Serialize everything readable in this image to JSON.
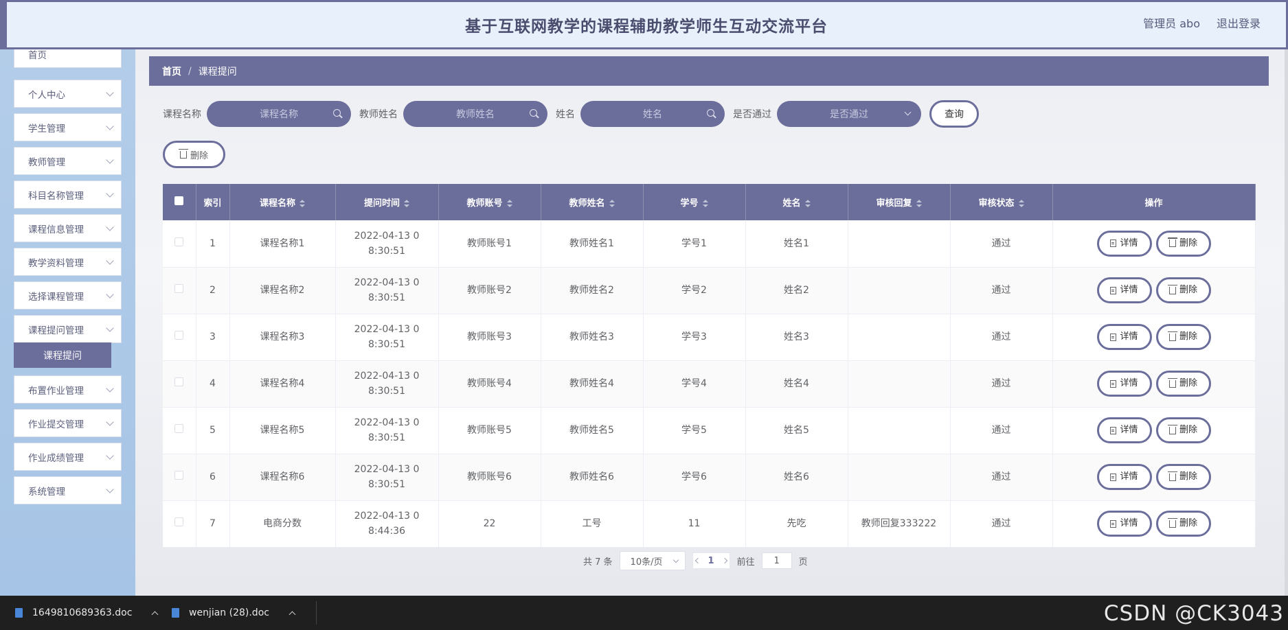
{
  "header": {
    "title": "基于互联网教学的课程辅助教学师生互动交流平台",
    "user": "管理员 abo",
    "logout": "退出登录"
  },
  "sidebar": {
    "items": [
      {
        "label": "首页"
      },
      {
        "label": "个人中心"
      },
      {
        "label": "学生管理"
      },
      {
        "label": "教师管理"
      },
      {
        "label": "科目名称管理"
      },
      {
        "label": "课程信息管理"
      },
      {
        "label": "教学资料管理"
      },
      {
        "label": "选择课程管理"
      },
      {
        "label": "课程提问管理"
      },
      {
        "label": "布置作业管理"
      },
      {
        "label": "作业提交管理"
      },
      {
        "label": "作业成绩管理"
      },
      {
        "label": "系统管理"
      }
    ],
    "active_sub": "课程提问"
  },
  "breadcrumb": {
    "home": "首页",
    "separator": "/",
    "current": "课程提问"
  },
  "filters": {
    "course_label": "课程名称",
    "course_placeholder": "课程名称",
    "teacher_label": "教师姓名",
    "teacher_placeholder": "教师姓名",
    "name_label": "姓名",
    "name_placeholder": "姓名",
    "passed_label": "是否通过",
    "passed_placeholder": "是否通过",
    "query_button": "查询"
  },
  "bulk_delete": "删除",
  "table": {
    "columns": [
      "索引",
      "课程名称",
      "提问时间",
      "教师账号",
      "教师姓名",
      "学号",
      "姓名",
      "审核回复",
      "审核状态",
      "操作"
    ],
    "rows": [
      {
        "index": "1",
        "course": "课程名称1",
        "time": "2022-04-13 08:30:51",
        "teacher_account": "教师账号1",
        "teacher_name": "教师姓名1",
        "student_no": "学号1",
        "name": "姓名1",
        "reply": "",
        "status": "通过"
      },
      {
        "index": "2",
        "course": "课程名称2",
        "time": "2022-04-13 08:30:51",
        "teacher_account": "教师账号2",
        "teacher_name": "教师姓名2",
        "student_no": "学号2",
        "name": "姓名2",
        "reply": "",
        "status": "通过"
      },
      {
        "index": "3",
        "course": "课程名称3",
        "time": "2022-04-13 08:30:51",
        "teacher_account": "教师账号3",
        "teacher_name": "教师姓名3",
        "student_no": "学号3",
        "name": "姓名3",
        "reply": "",
        "status": "通过"
      },
      {
        "index": "4",
        "course": "课程名称4",
        "time": "2022-04-13 08:30:51",
        "teacher_account": "教师账号4",
        "teacher_name": "教师姓名4",
        "student_no": "学号4",
        "name": "姓名4",
        "reply": "",
        "status": "通过"
      },
      {
        "index": "5",
        "course": "课程名称5",
        "time": "2022-04-13 08:30:51",
        "teacher_account": "教师账号5",
        "teacher_name": "教师姓名5",
        "student_no": "学号5",
        "name": "姓名5",
        "reply": "",
        "status": "通过"
      },
      {
        "index": "6",
        "course": "课程名称6",
        "time": "2022-04-13 08:30:51",
        "teacher_account": "教师账号6",
        "teacher_name": "教师姓名6",
        "student_no": "学号6",
        "name": "姓名6",
        "reply": "",
        "status": "通过"
      },
      {
        "index": "7",
        "course": "电商分数",
        "time": "2022-04-13 08:44:36",
        "teacher_account": "22",
        "teacher_name": "工号",
        "student_no": "11",
        "name": "先吃",
        "reply": "教师回复333222",
        "status": "通过"
      }
    ],
    "detail_button": "详情",
    "delete_button": "删除"
  },
  "pagination": {
    "total": "共 7 条",
    "page_size": "10条/页",
    "current_page": "1",
    "goto_prefix": "前往",
    "goto_value": "1",
    "goto_suffix": "页"
  },
  "taskbar": {
    "files": [
      "1649810689363.doc",
      "wenjian (28).doc"
    ],
    "watermark": "CSDN @CK3043"
  },
  "colors": {
    "accent": "#6b6d9a",
    "header_bg": "#e8f1fb",
    "sidebar_bg": "#b3cde9"
  }
}
